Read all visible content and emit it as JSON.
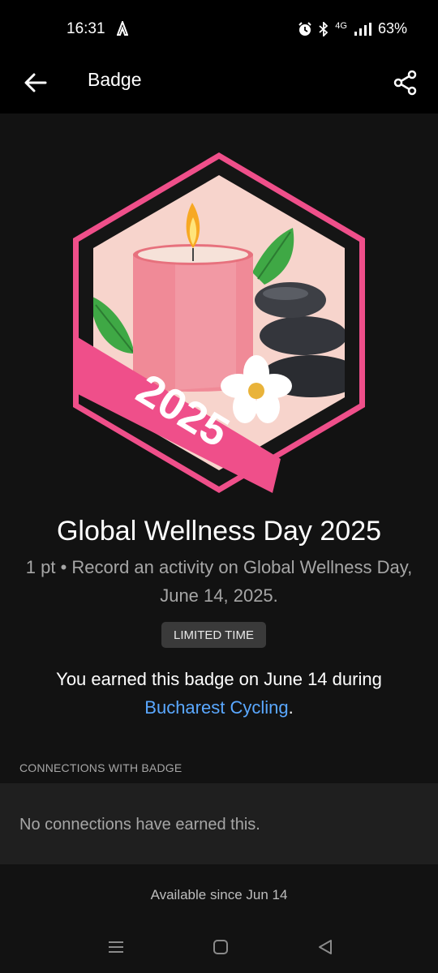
{
  "status_bar": {
    "time": "16:31",
    "network": "4G",
    "battery": "63%",
    "icons": [
      "activity-icon",
      "alarm-icon",
      "bluetooth-icon",
      "signal-icon"
    ]
  },
  "app_bar": {
    "title": "Badge",
    "icons": [
      "back-arrow-icon",
      "share-icon"
    ]
  },
  "badge": {
    "year_banner": "2025",
    "title": "Global Wellness Day 2025",
    "description": "1 pt • Record an activity on Global Wellness Day, June 14, 2025.",
    "tag": "LIMITED TIME",
    "earned_prefix": "You earned this badge on June 14 during ",
    "earned_link": "Bucharest Cycling",
    "earned_suffix": "."
  },
  "connections": {
    "section_label": "CONNECTIONS WITH BADGE",
    "empty_text": "No connections have earned this."
  },
  "footer": {
    "available_since": "Available since Jun 14"
  },
  "nav_bar": {
    "icons": [
      "recents-icon",
      "home-icon",
      "back-icon"
    ]
  },
  "colors": {
    "background": "#121212",
    "link": "#5aa8ff",
    "badge_pink": "#ef4f8a",
    "tag_bg": "#3a3a3a"
  }
}
